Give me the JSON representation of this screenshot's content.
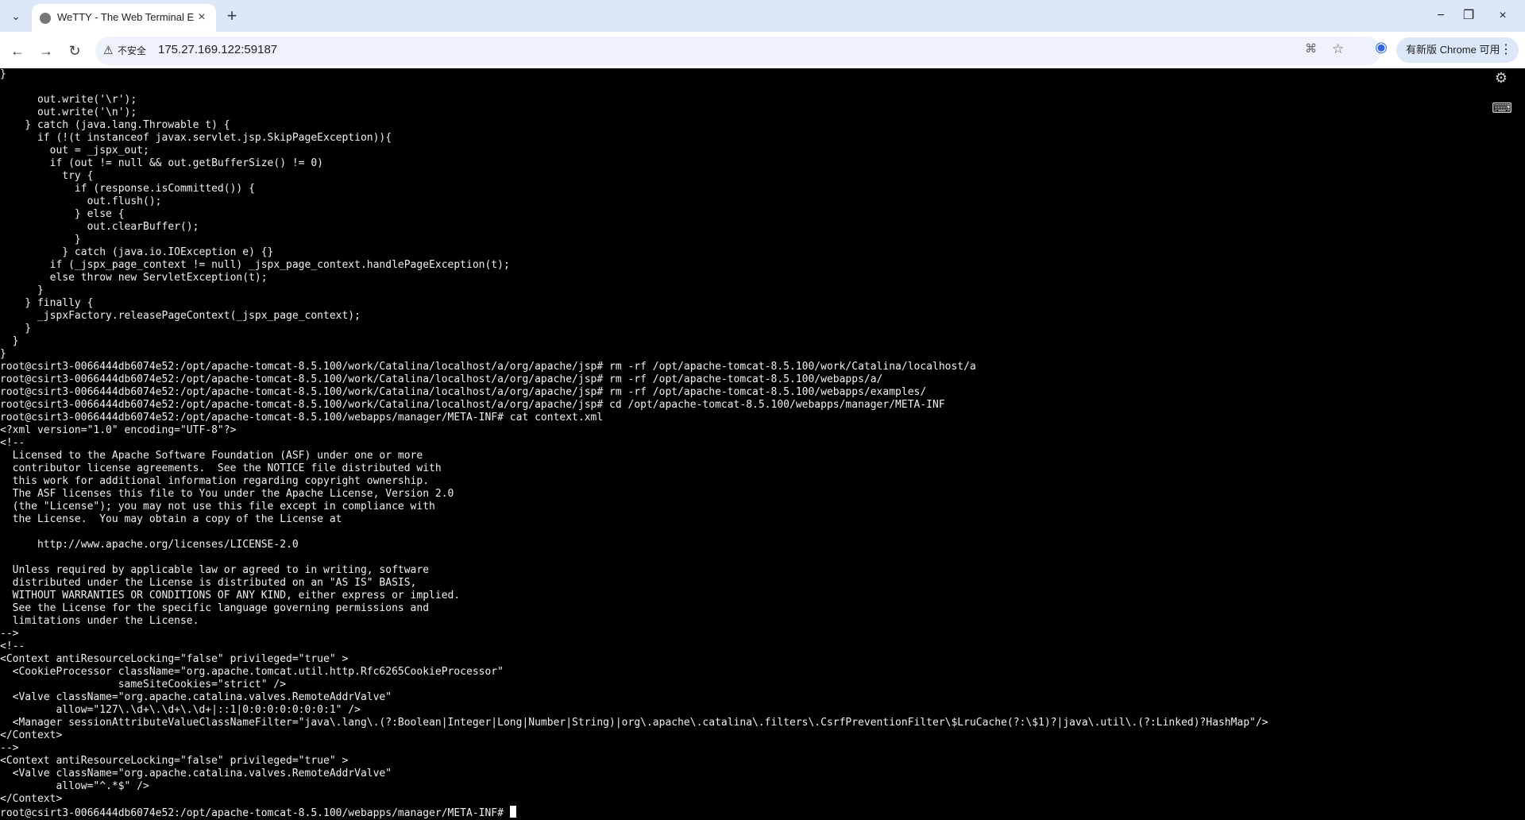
{
  "browser": {
    "tab_title": "WeTTY - The Web Terminal E",
    "address_security": "不安全",
    "url": "175.27.169.122:59187",
    "update_label": "有新版 Chrome 可用",
    "icons": {
      "tab_menu": "chevron-down-icon",
      "new_tab": "plus-icon",
      "back": "arrow-left-icon",
      "forward": "arrow-right-icon",
      "reload": "reload-icon",
      "security": "warning-icon",
      "translate": "translate-icon",
      "bookmark": "star-icon",
      "profile": "account-circle-icon",
      "menu": "three-dots-icon",
      "minimize": "minimize-icon",
      "maximize": "restore-icon",
      "close": "close-icon",
      "settings": "gears-icon",
      "keyboard": "keyboard-icon"
    }
  },
  "terminal": {
    "lines": [
      "}",
      "",
      "      out.write('\\r');",
      "      out.write('\\n');",
      "    } catch (java.lang.Throwable t) {",
      "      if (!(t instanceof javax.servlet.jsp.SkipPageException)){",
      "        out = _jspx_out;",
      "        if (out != null && out.getBufferSize() != 0)",
      "          try {",
      "            if (response.isCommitted()) {",
      "              out.flush();",
      "            } else {",
      "              out.clearBuffer();",
      "            }",
      "          } catch (java.io.IOException e) {}",
      "        if (_jspx_page_context != null) _jspx_page_context.handlePageException(t);",
      "        else throw new ServletException(t);",
      "      }",
      "    } finally {",
      "      _jspxFactory.releasePageContext(_jspx_page_context);",
      "    }",
      "  }",
      "}",
      "root@csirt3-0066444db6074e52:/opt/apache-tomcat-8.5.100/work/Catalina/localhost/a/org/apache/jsp# rm -rf /opt/apache-tomcat-8.5.100/work/Catalina/localhost/a",
      "root@csirt3-0066444db6074e52:/opt/apache-tomcat-8.5.100/work/Catalina/localhost/a/org/apache/jsp# rm -rf /opt/apache-tomcat-8.5.100/webapps/a/",
      "root@csirt3-0066444db6074e52:/opt/apache-tomcat-8.5.100/work/Catalina/localhost/a/org/apache/jsp# rm -rf /opt/apache-tomcat-8.5.100/webapps/examples/",
      "root@csirt3-0066444db6074e52:/opt/apache-tomcat-8.5.100/work/Catalina/localhost/a/org/apache/jsp# cd /opt/apache-tomcat-8.5.100/webapps/manager/META-INF",
      "root@csirt3-0066444db6074e52:/opt/apache-tomcat-8.5.100/webapps/manager/META-INF# cat context.xml",
      "<?xml version=\"1.0\" encoding=\"UTF-8\"?>",
      "<!--",
      "  Licensed to the Apache Software Foundation (ASF) under one or more",
      "  contributor license agreements.  See the NOTICE file distributed with",
      "  this work for additional information regarding copyright ownership.",
      "  The ASF licenses this file to You under the Apache License, Version 2.0",
      "  (the \"License\"); you may not use this file except in compliance with",
      "  the License.  You may obtain a copy of the License at",
      "",
      "      http://www.apache.org/licenses/LICENSE-2.0",
      "",
      "  Unless required by applicable law or agreed to in writing, software",
      "  distributed under the License is distributed on an \"AS IS\" BASIS,",
      "  WITHOUT WARRANTIES OR CONDITIONS OF ANY KIND, either express or implied.",
      "  See the License for the specific language governing permissions and",
      "  limitations under the License.",
      "-->",
      "<!--",
      "<Context antiResourceLocking=\"false\" privileged=\"true\" >",
      "  <CookieProcessor className=\"org.apache.tomcat.util.http.Rfc6265CookieProcessor\"",
      "                   sameSiteCookies=\"strict\" />",
      "  <Valve className=\"org.apache.catalina.valves.RemoteAddrValve\"",
      "         allow=\"127\\.\\d+\\.\\d+\\.\\d+|::1|0:0:0:0:0:0:0:1\" />",
      "  <Manager sessionAttributeValueClassNameFilter=\"java\\.lang\\.(?:Boolean|Integer|Long|Number|String)|org\\.apache\\.catalina\\.filters\\.CsrfPreventionFilter\\$LruCache(?:\\$1)?|java\\.util\\.(?:Linked)?HashMap\"/>",
      "</Context>",
      "-->",
      "<Context antiResourceLocking=\"false\" privileged=\"true\" >",
      "  <Valve className=\"org.apache.catalina.valves.RemoteAddrValve\"",
      "         allow=\"^.*$\" />",
      "</Context>"
    ],
    "prompt": "root@csirt3-0066444db6074e52:/opt/apache-tomcat-8.5.100/webapps/manager/META-INF# "
  }
}
